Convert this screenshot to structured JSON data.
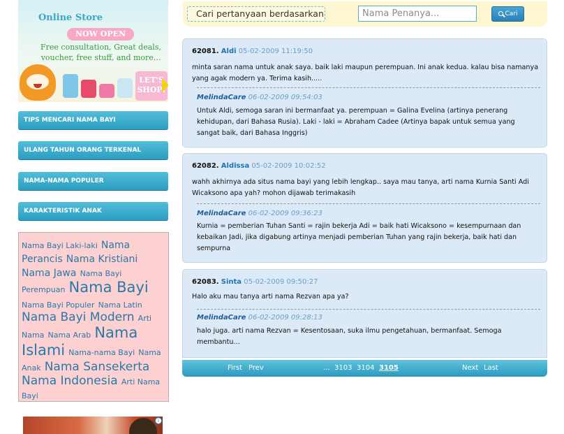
{
  "banner": {
    "title": "Online Store",
    "pill": "NOW OPEN",
    "text": "Free consultation, Great deals, voucher, free stuff, and more...",
    "cta": "LET'S SHOP!"
  },
  "nav": [
    "TIPS MENCARI NAMA BAYI",
    "ULANG TAHUN ORANG TERKENAL",
    "NAMA-NAMA POPULER",
    "KARAKTERISTIK ANAK"
  ],
  "tagcloud": [
    {
      "text": "Nama Bayi Laki-laki",
      "size": 1
    },
    {
      "text": "Nama Perancis",
      "size": 2
    },
    {
      "text": "Nama Kristiani",
      "size": 2
    },
    {
      "text": "Nama Jawa",
      "size": 2
    },
    {
      "text": "Nama Bayi Perempuan",
      "size": 1
    },
    {
      "text": "Nama Bayi",
      "size": 4
    },
    {
      "text": "Nama Bayi Populer",
      "size": 1
    },
    {
      "text": "Nama Latin",
      "size": 1
    },
    {
      "text": "Nama Bayi Modern",
      "size": 3
    },
    {
      "text": "Arti Nama",
      "size": 1
    },
    {
      "text": "Nama Arab",
      "size": 1
    },
    {
      "text": "Nama Islami",
      "size": 4
    },
    {
      "text": "Nama-nama Bayi",
      "size": 1
    },
    {
      "text": "Nama Anak",
      "size": 1
    },
    {
      "text": "Nama Sansekerta",
      "size": 3
    },
    {
      "text": "Nama Indonesia",
      "size": 3
    },
    {
      "text": "Arti Nama Bayi",
      "size": 1
    }
  ],
  "search": {
    "label": "Cari pertanyaan berdasarkan",
    "placeholder": "Nama Penanya...",
    "button": "Cari"
  },
  "questions": [
    {
      "id": "62081.",
      "name": "Aldi",
      "date": "05-02-2009 11:19:50",
      "text": "minta saran nama untuk anak saya. baik laki maupun perempuan. Ini anak kedua. kalau bisa namanya yang agak modern ya. Terima kasih.....",
      "reply_name": "MelindaCare",
      "reply_date": "06-02-2009 09:54:03",
      "reply": "Untuk Aldi, semoga saran ini bermanfaat ya. perempuan = Galina Evelina (artinya penerang kehidupan, dari Bahasa Rusia). Laki - laki = Abraham Cadee (Artinya bapak untuk semua yang sangat baik, dari Bahasa Inggris)"
    },
    {
      "id": "62082.",
      "name": "Aldissa",
      "date": "05-02-2009 10:02:52",
      "text": "wahh akhirnya ada situs nama bayi yang lebih lengkap.. saya mau tanya, arti nama Kurnia Santi Adi Wicaksono apa yah? mohon dijawab terimakasih",
      "reply_name": "MelindaCare",
      "reply_date": "06-02-2009 09:36:23",
      "reply": "Kurnia = pemberian Tuhan Santi = rajin bekerja Adi = baik hati Wicaksono = kesempurnaan dan kebaikan Jadi, jika digabung artinya menjadi pemberian Tuhan yang rajin bekerja, baik hati dan sempurna"
    },
    {
      "id": "62083.",
      "name": "Sinta",
      "date": "05-02-2009 09:50:27",
      "text": "Halo aku mau tanya arti nama Rezvan apa ya?",
      "reply_name": "MelindaCare",
      "reply_date": "06-02-2009 09:28:13",
      "reply": "halo juga. arti nama Rezvan = Kesentosaan, suka ilmu pengetahuan, bermanfaat. Semoga membantu..."
    }
  ],
  "pager": {
    "first": "First",
    "prev": "Prev",
    "dots": "...",
    "pages": [
      "3103",
      "3104",
      "3105"
    ],
    "current": "3105",
    "next": "Next",
    "last": "Last"
  },
  "ad": {
    "info_icon": "i"
  },
  "colors": {
    "nav_button": "#2b9ec1",
    "card_bg": "#dce9f6",
    "tagcloud_bg": "#fdd1d1",
    "searchbar_bg": "#fdf6d1",
    "link_blue": "#1e73b1"
  }
}
